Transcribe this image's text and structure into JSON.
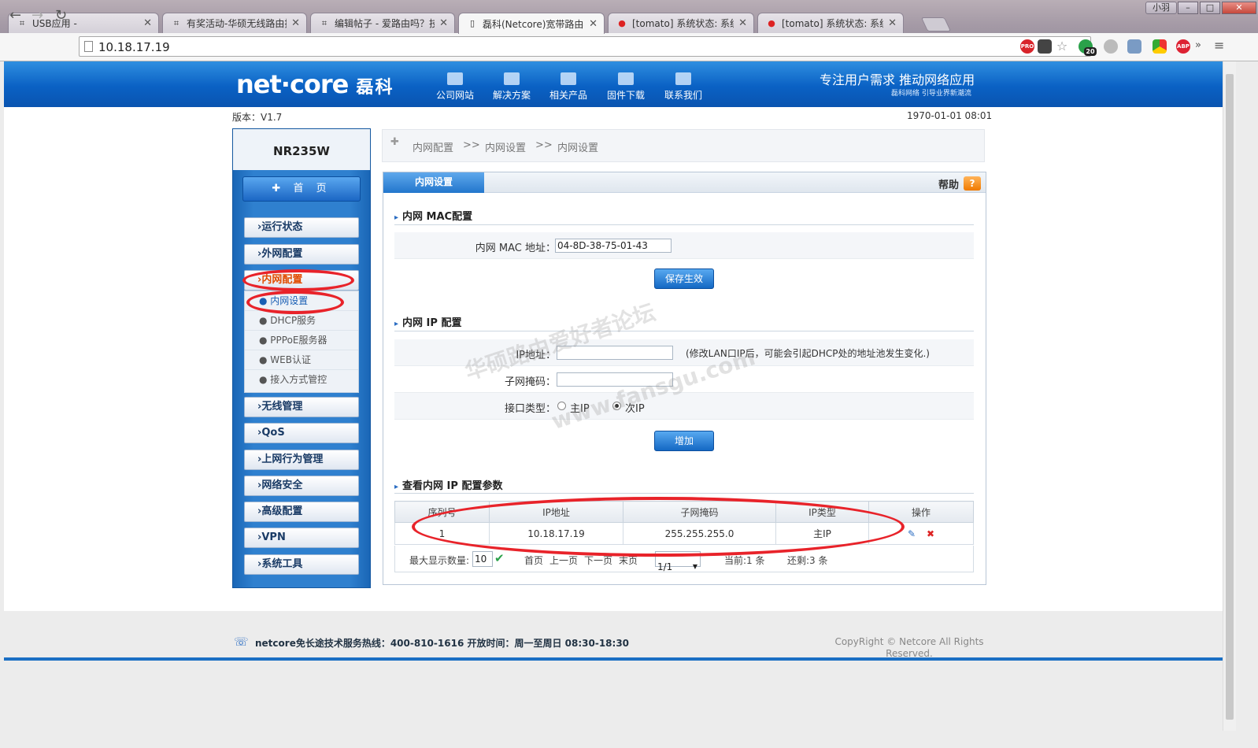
{
  "browser": {
    "tabs": [
      {
        "title": "USB应用 -",
        "icon": "router-icon"
      },
      {
        "title": "有奖活动-华硕无线路由技",
        "icon": "router-icon"
      },
      {
        "title": "编辑帖子 - 爱路由吗？技",
        "icon": "router-icon"
      },
      {
        "title": "磊科(Netcore)宽带路由器",
        "icon": "page-icon"
      },
      {
        "title": "[tomato] 系统状态: 系统",
        "icon": "tomato-icon"
      },
      {
        "title": "[tomato] 系统状态: 系统",
        "icon": "tomato-icon"
      }
    ],
    "user_label": "小羽",
    "url": "10.18.17.19",
    "ext_badge": "20"
  },
  "header": {
    "logo": "net·core",
    "logo_cn": "磊科",
    "nav": [
      "公司网站",
      "解决方案",
      "相关产品",
      "固件下载",
      "联系我们"
    ],
    "slogan": "专注用户需求   推动网络应用",
    "slogan_sub": "磊科网络 引导业界新潮流"
  },
  "version": "版本：V1.7",
  "datetime": "1970-01-01 08:01",
  "sidebar": {
    "model": "NR235W",
    "home": "首 页",
    "items": [
      "运行状态",
      "外网配置",
      "内网配置",
      "无线管理",
      "QoS",
      "上网行为管理",
      "网络安全",
      "高级配置",
      "VPN",
      "系统工具"
    ],
    "sub_items": [
      "内网设置",
      "DHCP服务",
      "PPPoE服务器",
      "WEB认证",
      "接入方式管控"
    ]
  },
  "breadcrumb": {
    "a": "内网配置",
    "sep": ">>",
    "b": "内网设置",
    "c": "内网设置"
  },
  "panel": {
    "tab": "内网设置",
    "help": "帮助",
    "mac_section": "内网 MAC配置",
    "mac_label": "内网 MAC 地址：",
    "mac_value": "04-8D-38-75-01-43",
    "save_label": "保存生效",
    "ip_section": "内网 IP 配置",
    "ip_label": "IP地址：",
    "ip_value": "",
    "ip_note": "(修改LAN口IP后，可能会引起DHCP处的地址池发生变化.)",
    "mask_label": "子网掩码：",
    "mask_value": "",
    "type_label": "接口类型：",
    "type_primary": "主IP",
    "type_secondary": "次IP",
    "add_label": "增加",
    "list_section": "查看内网 IP 配置参数",
    "columns": [
      "序列号",
      "IP地址",
      "子网掩码",
      "IP类型",
      "操作"
    ],
    "rows": [
      {
        "idx": "1",
        "ip": "10.18.17.19",
        "mask": "255.255.255.0",
        "type": "主IP"
      }
    ],
    "pager": {
      "max_label": "最大显示数量:",
      "max_value": "10",
      "first": "首页",
      "prev": "上一页",
      "next": "下一页",
      "last": "末页",
      "page_value": "1/1",
      "current": "当前:1 条",
      "remaining": "还剩:3 条"
    }
  },
  "footer": {
    "hotline": "netcore免长途技术服务热线：400-810-1616   开放时间：周一至周日 08:30-18:30",
    "copyright": "CopyRight © Netcore All Rights Reserved."
  },
  "watermark": {
    "line1": "华硕路由爱好者论坛",
    "line2": "www.fansgu.com"
  },
  "colors": {
    "accent": "#1a6fc4",
    "annotation": "#e8232a",
    "selected_menu": "#e14b00"
  }
}
